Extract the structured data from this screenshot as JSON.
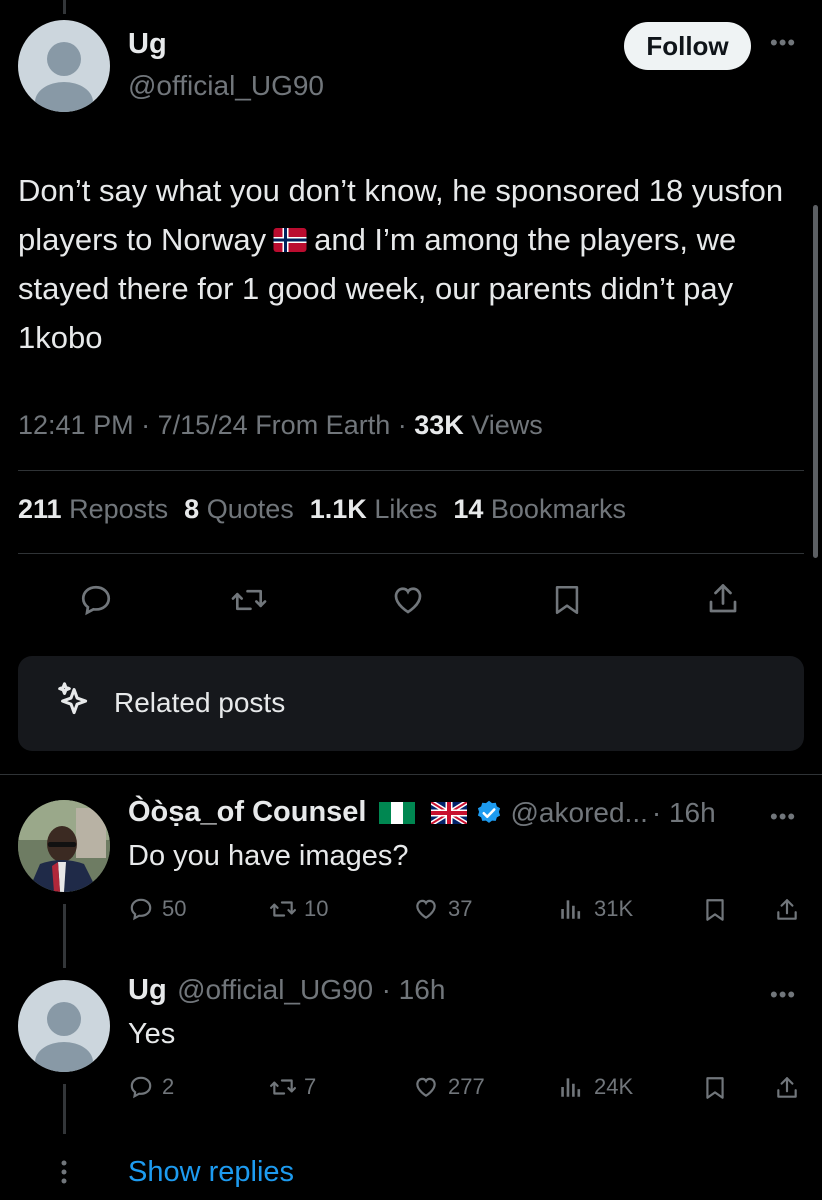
{
  "tweet": {
    "author_name": "Ug",
    "author_handle": "@official_UG90",
    "follow_label": "Follow",
    "text_part1": "Don’t say what you don’t know, he sponsored 18 yusfon players to Norway",
    "text_part2": "and I’m among the players, we stayed there for 1 good week, our parents didn’t pay 1kobo",
    "time": "12:41 PM",
    "date": "7/15/24",
    "source": "From Earth",
    "views_count": "33K",
    "views_label": "Views",
    "reposts_count": "211",
    "reposts_label": "Reposts",
    "quotes_count": "8",
    "quotes_label": "Quotes",
    "likes_count": "1.1K",
    "likes_label": "Likes",
    "bookmarks_count": "14",
    "bookmarks_label": "Bookmarks"
  },
  "actions": [
    "reply-icon",
    "repost-icon",
    "like-icon",
    "bookmark-icon",
    "share-icon"
  ],
  "related_posts_label": "Related posts",
  "replies": [
    {
      "name": "Òòṣa_of Counsel",
      "handle": "@akored...",
      "time": "· 16h",
      "text": "Do you have images?",
      "replies": "50",
      "reposts": "10",
      "likes": "37",
      "views": "31K"
    },
    {
      "name": "Ug",
      "handle": "@official_UG90",
      "time": "· 16h",
      "text": "Yes",
      "replies": "2",
      "reposts": "7",
      "likes": "277",
      "views": "24K"
    }
  ],
  "show_replies_label": "Show replies",
  "colors": {
    "background": "#000000",
    "text": "#e7e9ea",
    "muted": "#71767b",
    "accent": "#1d9bf0",
    "verified": "#1d9bf0"
  }
}
